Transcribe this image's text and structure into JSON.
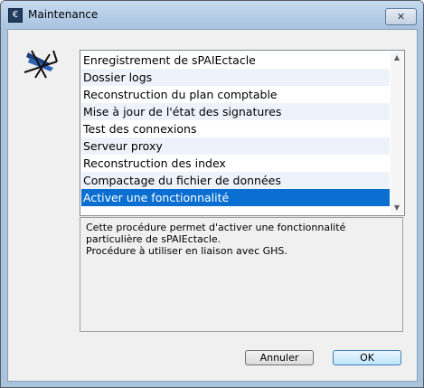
{
  "window": {
    "title": "Maintenance",
    "app_icon_glyph": "€",
    "close_glyph": "✕"
  },
  "list": {
    "items": [
      "Enregistrement de sPAIEctacle",
      "Dossier logs",
      "Reconstruction du plan comptable",
      "Mise à jour de l'état des signatures",
      "Test des connexions",
      "Serveur proxy",
      "Reconstruction des index",
      "Compactage du fichier de données",
      "Activer une fonctionnalité"
    ],
    "selected_index": 8,
    "scroll_up_glyph": "▲",
    "scroll_down_glyph": "▼"
  },
  "description": {
    "lines": [
      "Cette procédure permet d'activer une fonctionnalité",
      "particulière de sPAIEctacle.",
      "Procédure à utiliser en liaison avec GHS."
    ]
  },
  "buttons": {
    "cancel_label": "Annuler",
    "ok_label": "OK"
  },
  "colors": {
    "selection": "#0a6fd1",
    "alt_row": "#eef2fb"
  }
}
